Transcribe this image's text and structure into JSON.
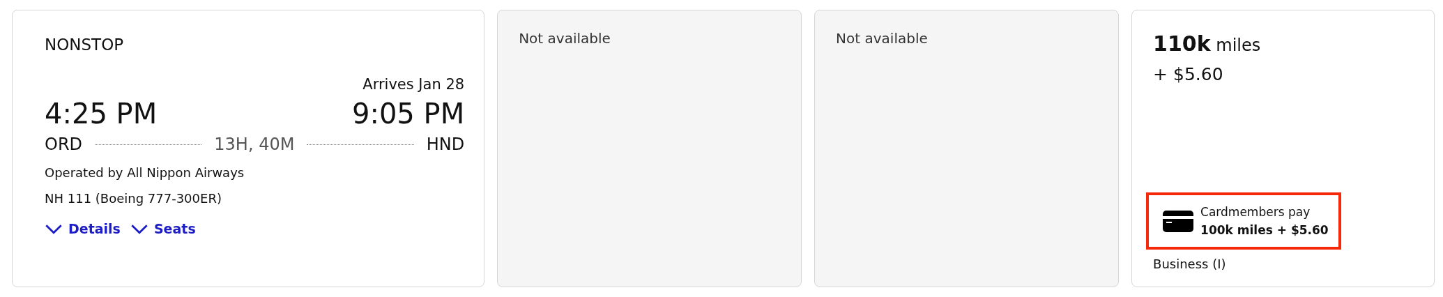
{
  "flight": {
    "stops": "NONSTOP",
    "arrival_note": "Arrives Jan 28",
    "depart_time": "4:25 PM",
    "arrive_time": "9:05 PM",
    "origin": "ORD",
    "duration": "13H, 40M",
    "destination": "HND",
    "operator": "Operated by All Nippon Airways",
    "flight_number": "NH 111 (Boeing 777-300ER)",
    "links": [
      {
        "label": "Details",
        "expanded": false
      },
      {
        "label": "Seats",
        "expanded": false
      }
    ]
  },
  "fares": [
    {
      "kind": "unavailable",
      "text": "Not available"
    },
    {
      "kind": "unavailable",
      "text": "Not available"
    },
    {
      "kind": "price",
      "price": "**110k** miles",
      "taxes": "+ $5.60",
      "cardmember": {
        "label": "Cardmembers pay",
        "price": "100k miles + $5.60",
        "highlighted": true
      },
      "cabin": "Business (I)"
    }
  ]
}
